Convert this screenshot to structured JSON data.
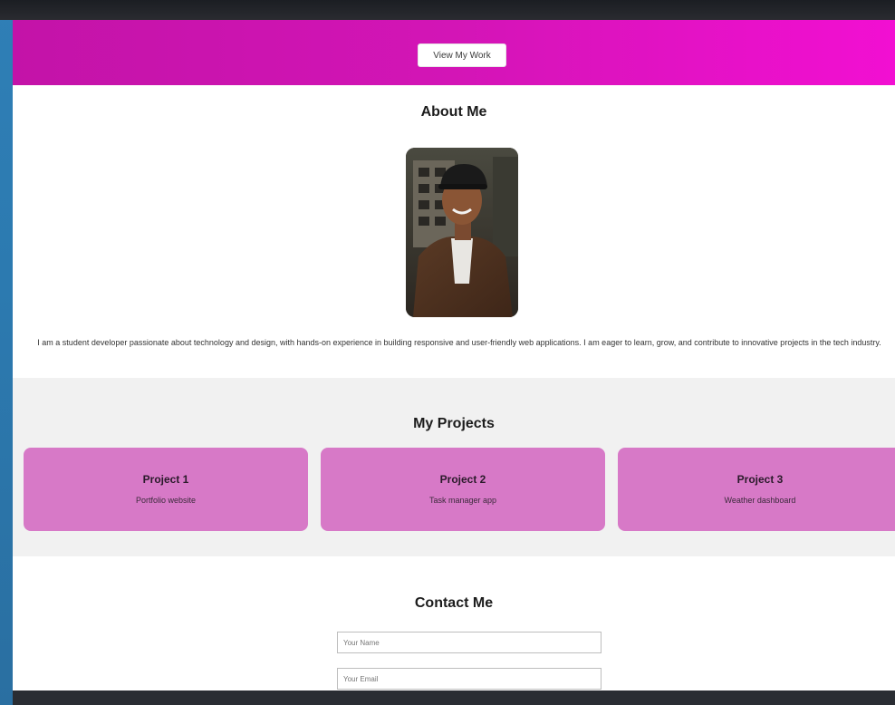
{
  "hero": {
    "button_label": "View My Work"
  },
  "about": {
    "title": "About Me",
    "text": "I am a student developer passionate about technology and design, with hands-on experience in building responsive and user-friendly web applications. I am eager to learn, grow, and contribute to innovative projects in the tech industry."
  },
  "projects": {
    "title": "My Projects",
    "items": [
      {
        "title": "Project 1",
        "desc": "Portfolio website"
      },
      {
        "title": "Project 2",
        "desc": "Task manager app"
      },
      {
        "title": "Project 3",
        "desc": "Weather dashboard"
      }
    ]
  },
  "contact": {
    "title": "Contact Me",
    "name_placeholder": "Your Name",
    "email_placeholder": "Your Email"
  },
  "colors": {
    "hero_gradient_start": "#c313a8",
    "hero_gradient_end": "#f20fd2",
    "project_card": "#d779c7",
    "projects_bg": "#f1f1f1"
  }
}
